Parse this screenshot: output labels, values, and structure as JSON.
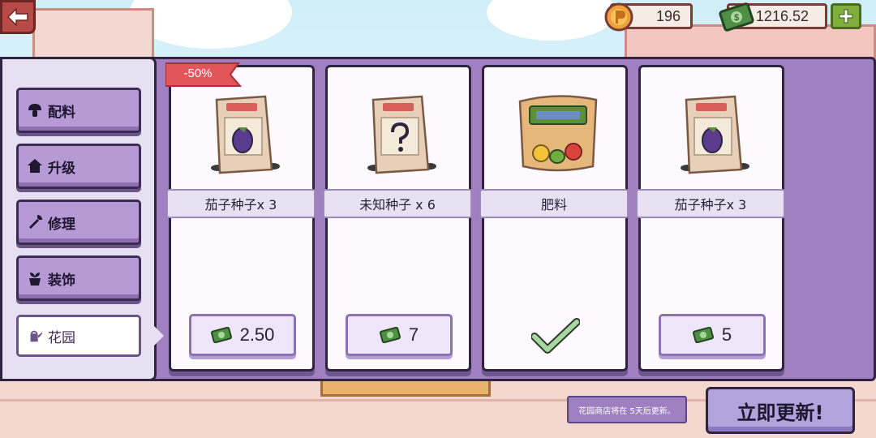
{
  "resources": {
    "coins": "196",
    "cash": "1216.52"
  },
  "sidebar": {
    "items": [
      {
        "label": "配料",
        "icon": "mushroom-icon",
        "active": false
      },
      {
        "label": "升级",
        "icon": "house-icon",
        "active": false
      },
      {
        "label": "修理",
        "icon": "wrench-icon",
        "active": false
      },
      {
        "label": "装饰",
        "icon": "plant-pot-icon",
        "active": false
      },
      {
        "label": "花园",
        "icon": "watering-can-icon",
        "active": true
      }
    ]
  },
  "shop": {
    "items": [
      {
        "name": "茄子种子x 3",
        "price": "2.50",
        "art": "eggplant-seed-bag",
        "badge": "-50%",
        "purchased": false
      },
      {
        "name": "未知种子 x 6",
        "price": "7",
        "art": "mystery-seed-bag",
        "badge": "",
        "purchased": false
      },
      {
        "name": "肥料",
        "price": "",
        "art": "fertilizer-sack",
        "badge": "",
        "purchased": true
      },
      {
        "name": "茄子种子x 3",
        "price": "5",
        "art": "eggplant-seed-bag",
        "badge": "",
        "purchased": false
      }
    ]
  },
  "footer": {
    "notice": "花园商店将在 5天后更新。",
    "refresh_label": "立即更新!"
  },
  "colors": {
    "panel": "#a180c2",
    "sidebar": "#e7dff2",
    "button": "#b69ad5",
    "outline": "#2f2340",
    "cash_green": "#5d9a4a",
    "coin_orange": "#f0a23a"
  }
}
